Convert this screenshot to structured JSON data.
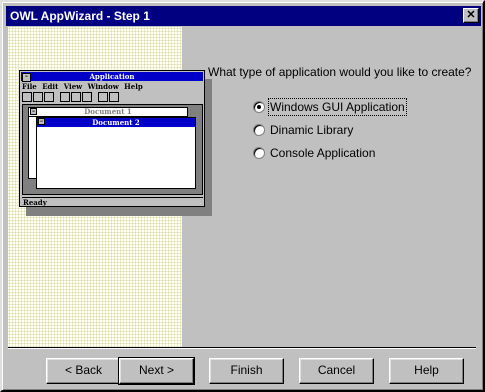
{
  "window": {
    "title": "OWL AppWizard - Step 1",
    "close_glyph": "✕"
  },
  "illustration": {
    "app_title": "Application",
    "sys_glyph": "–",
    "menu": [
      "File",
      "Edit",
      "View",
      "Window",
      "Help"
    ],
    "doc1_title": "Document 1",
    "doc2_title": "Document 2",
    "status": "Ready"
  },
  "main": {
    "question": "What type of application would you like to create?",
    "options": [
      {
        "label": "Windows GUI Application",
        "selected": true
      },
      {
        "label": "Dinamic Library",
        "selected": false
      },
      {
        "label": "Console Application",
        "selected": false
      }
    ]
  },
  "buttons": {
    "back": "< Back",
    "next": "Next >",
    "finish": "Finish",
    "cancel": "Cancel",
    "help": "Help"
  }
}
